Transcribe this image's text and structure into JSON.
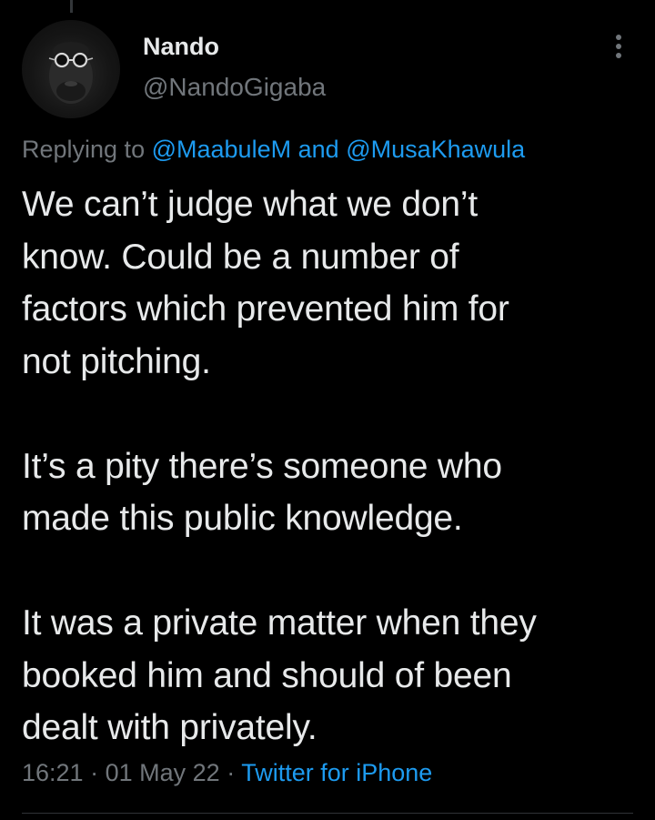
{
  "author": {
    "display_name": "Nando",
    "handle": "@NandoGigaba"
  },
  "reply": {
    "prefix": "Replying to",
    "mention_1": "@MaabuleM",
    "joiner": "and",
    "mention_2": "@MusaKhawula"
  },
  "tweet": {
    "paragraphs": [
      [
        "We can’t judge what we don’t",
        "know. Could be a number of",
        "factors which prevented him for",
        "not pitching."
      ],
      [
        "It’s a pity there’s someone who",
        "made this public knowledge."
      ],
      [
        "It was a private matter when they",
        "booked him and should of been",
        "dealt with privately."
      ]
    ]
  },
  "meta": {
    "time": "16:21",
    "separator": "·",
    "date": "01 May 22",
    "source": "Twitter for iPhone"
  },
  "colors": {
    "background": "#000000",
    "text": "#e7e9ea",
    "secondary": "#71767b",
    "link": "#1d9bf0"
  },
  "icons": {
    "more": "more-vertical-icon",
    "avatar": "profile-photo"
  }
}
